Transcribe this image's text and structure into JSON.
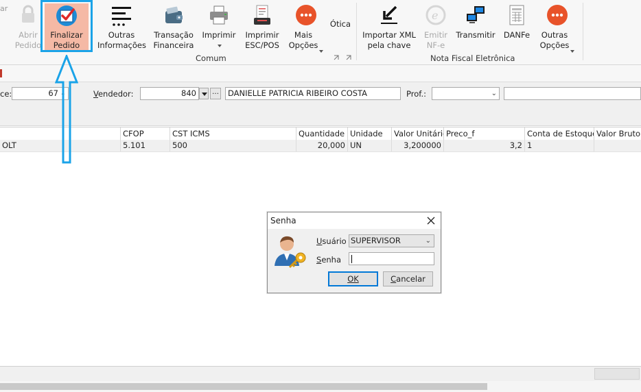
{
  "ribbon": {
    "fragment_label": "ar",
    "abrir_pedido": "Abrir\nPedido",
    "finalizar_pedido": "Finalizar\nPedido",
    "outras_informacoes": "Outras\nInformações",
    "transacao_financeira": "Transação\nFinanceira",
    "imprimir": "Imprimir",
    "imprimir_esc_pos": "Imprimir\nESC/POS",
    "mais_opcoes": "Mais\nOpções",
    "otica": "Ótica",
    "importar_xml": "Importar XML\npela chave",
    "emitir_nfe": "Emitir\nNF-e",
    "transmitir": "Transmitir",
    "danfe": "DANFe",
    "outras_opcoes": "Outras\nOpções",
    "group_comum": "Comum",
    "group_nfe": "Nota Fiscal Eletrônica",
    "colors": {
      "accent_selected": "#f5b9a5",
      "callout": "#1aa3e8",
      "orange_icon": "#e8532a"
    }
  },
  "fields": {
    "left_label_fragment": "ce:",
    "left_value": "67",
    "vendedor_label": "Vendedor:",
    "vendedor_code": "840",
    "vendedor_name": "DANIELLE PATRICIA RIBEIRO COSTA",
    "prof_label": "Prof.:"
  },
  "grid": {
    "columns": [
      "CFOP",
      "CST ICMS",
      "Quantidade",
      "Unidade",
      "Valor Unitário",
      "Preco_f",
      "Conta de Estoque",
      "Valor Bruto"
    ],
    "row": {
      "fragment": "OLT",
      "cfop": "5.101",
      "cst_icms": "500",
      "quantidade": "20,000",
      "unidade": "UN",
      "valor_unitario": "3,200000",
      "preco_f": "3,2",
      "conta_estoque": "1",
      "valor_bruto": ""
    }
  },
  "dialog": {
    "title": "Senha",
    "usuario_label": "Usuário",
    "usuario_value": "SUPERVISOR",
    "senha_label": "Senha",
    "senha_value": "",
    "ok_label": "OK",
    "cancelar_label": "Cancelar"
  }
}
